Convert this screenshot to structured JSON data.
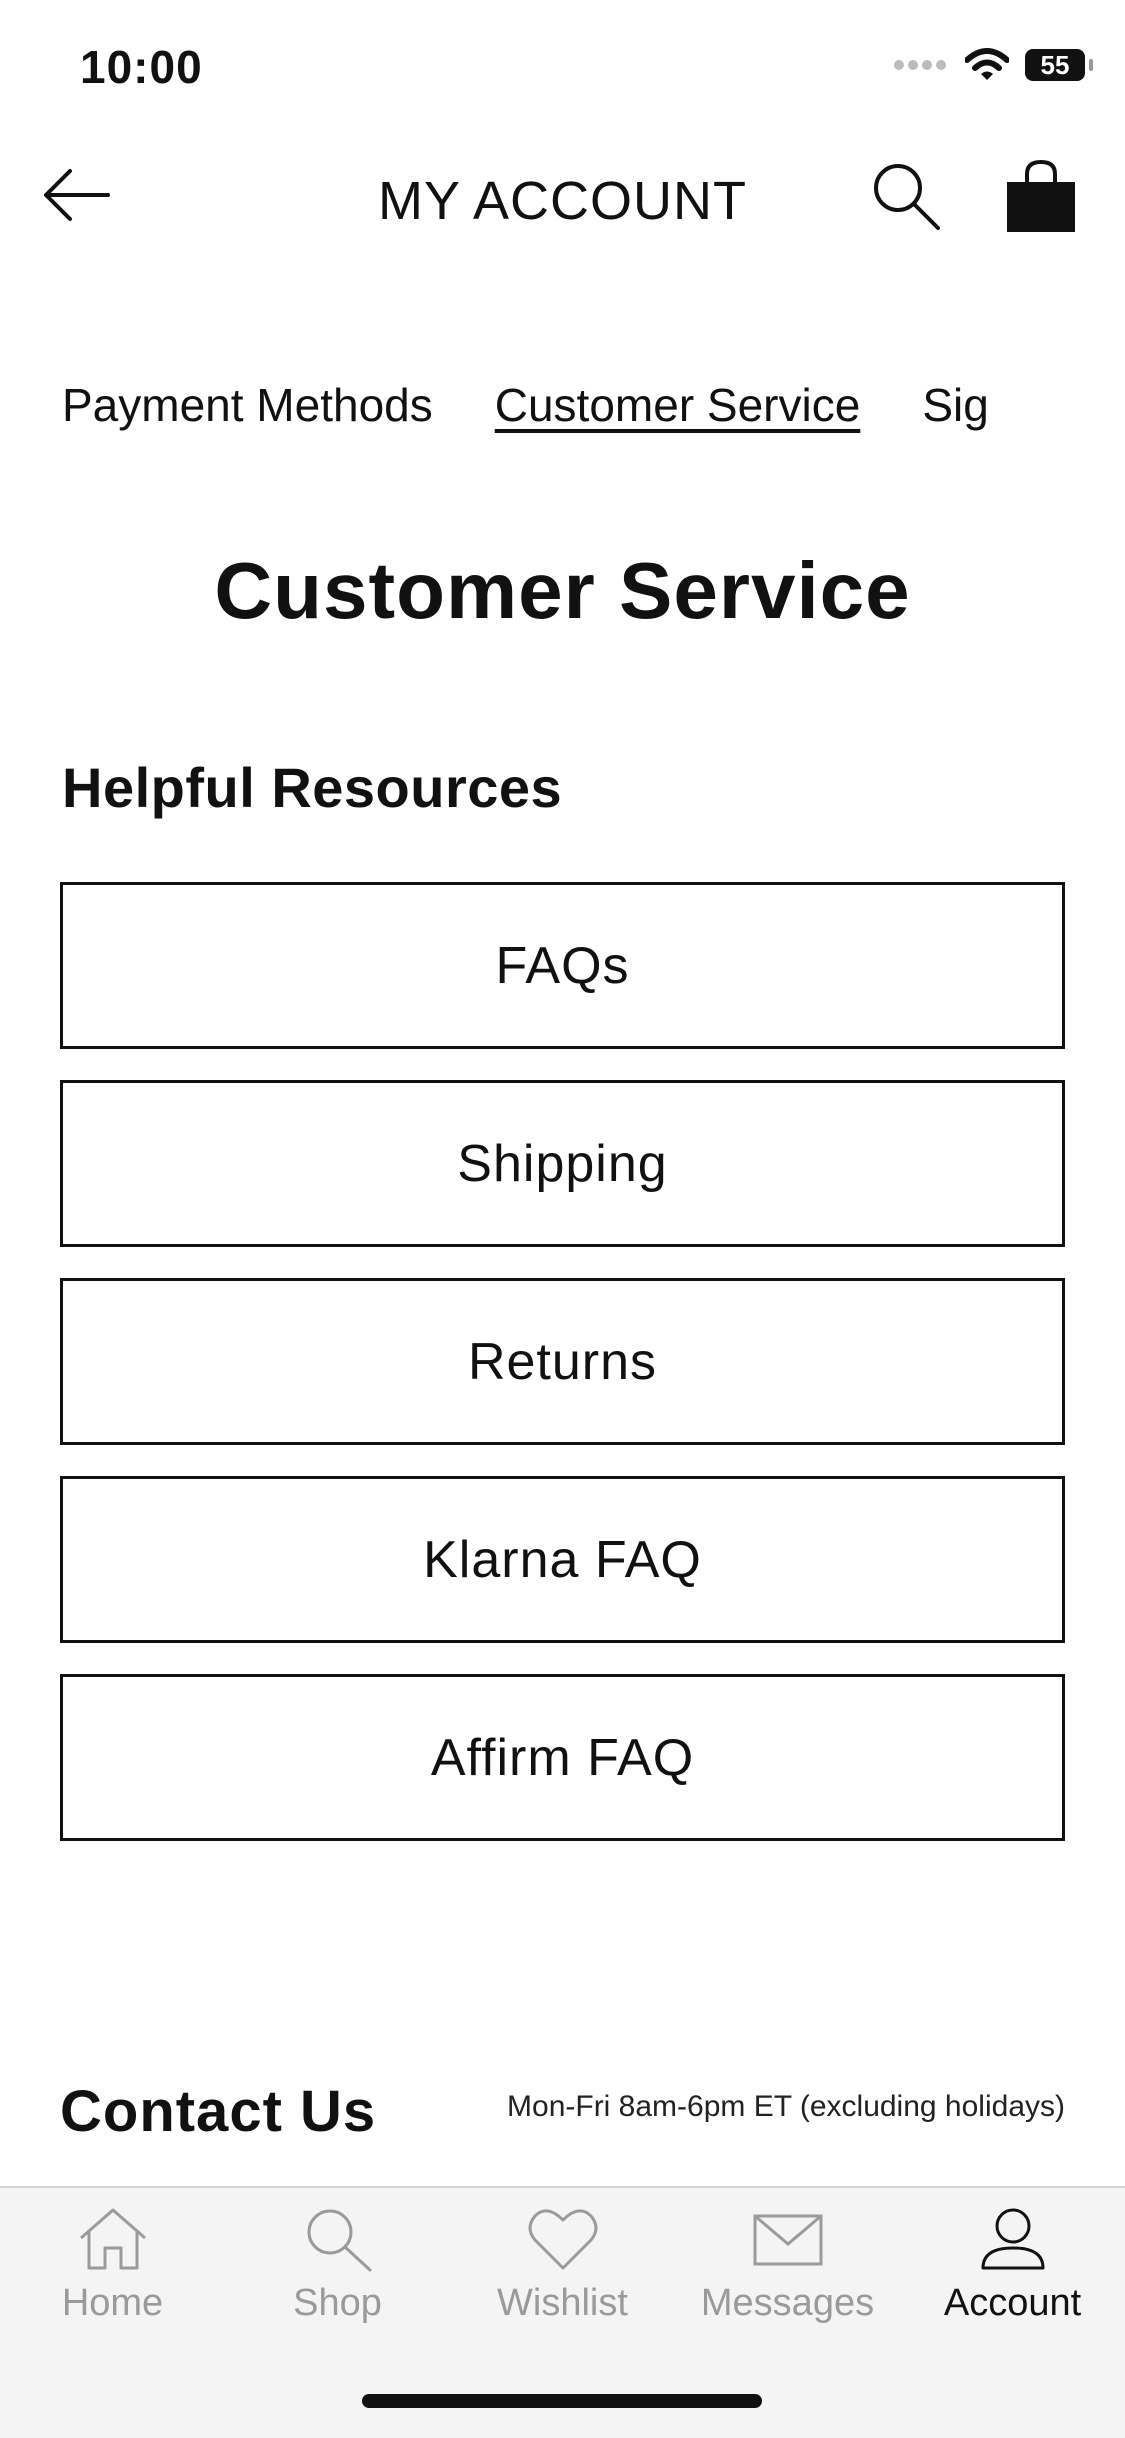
{
  "status_bar": {
    "time": "10:00",
    "battery": "55"
  },
  "header": {
    "title": "MY ACCOUNT"
  },
  "tabs": [
    {
      "label": "Payment Methods",
      "active": false
    },
    {
      "label": "Customer Service",
      "active": true
    },
    {
      "label": "Sig",
      "active": false
    }
  ],
  "page": {
    "title": "Customer Service",
    "helpful_resources": {
      "heading": "Helpful Resources",
      "buttons": [
        "FAQs",
        "Shipping",
        "Returns",
        "Klarna FAQ",
        "Affirm FAQ"
      ]
    },
    "contact": {
      "heading": "Contact Us",
      "hours": "Mon-Fri 8am-6pm ET (excluding holidays)"
    }
  },
  "tabbar": {
    "items": [
      {
        "label": "Home",
        "icon": "home-icon"
      },
      {
        "label": "Shop",
        "icon": "search-icon"
      },
      {
        "label": "Wishlist",
        "icon": "heart-icon"
      },
      {
        "label": "Messages",
        "icon": "envelope-icon"
      },
      {
        "label": "Account",
        "icon": "person-icon",
        "active": true
      }
    ]
  },
  "colors": {
    "text": "#111111",
    "inactive": "#9a9a9a",
    "tabbar_bg": "#f4f4f4"
  }
}
